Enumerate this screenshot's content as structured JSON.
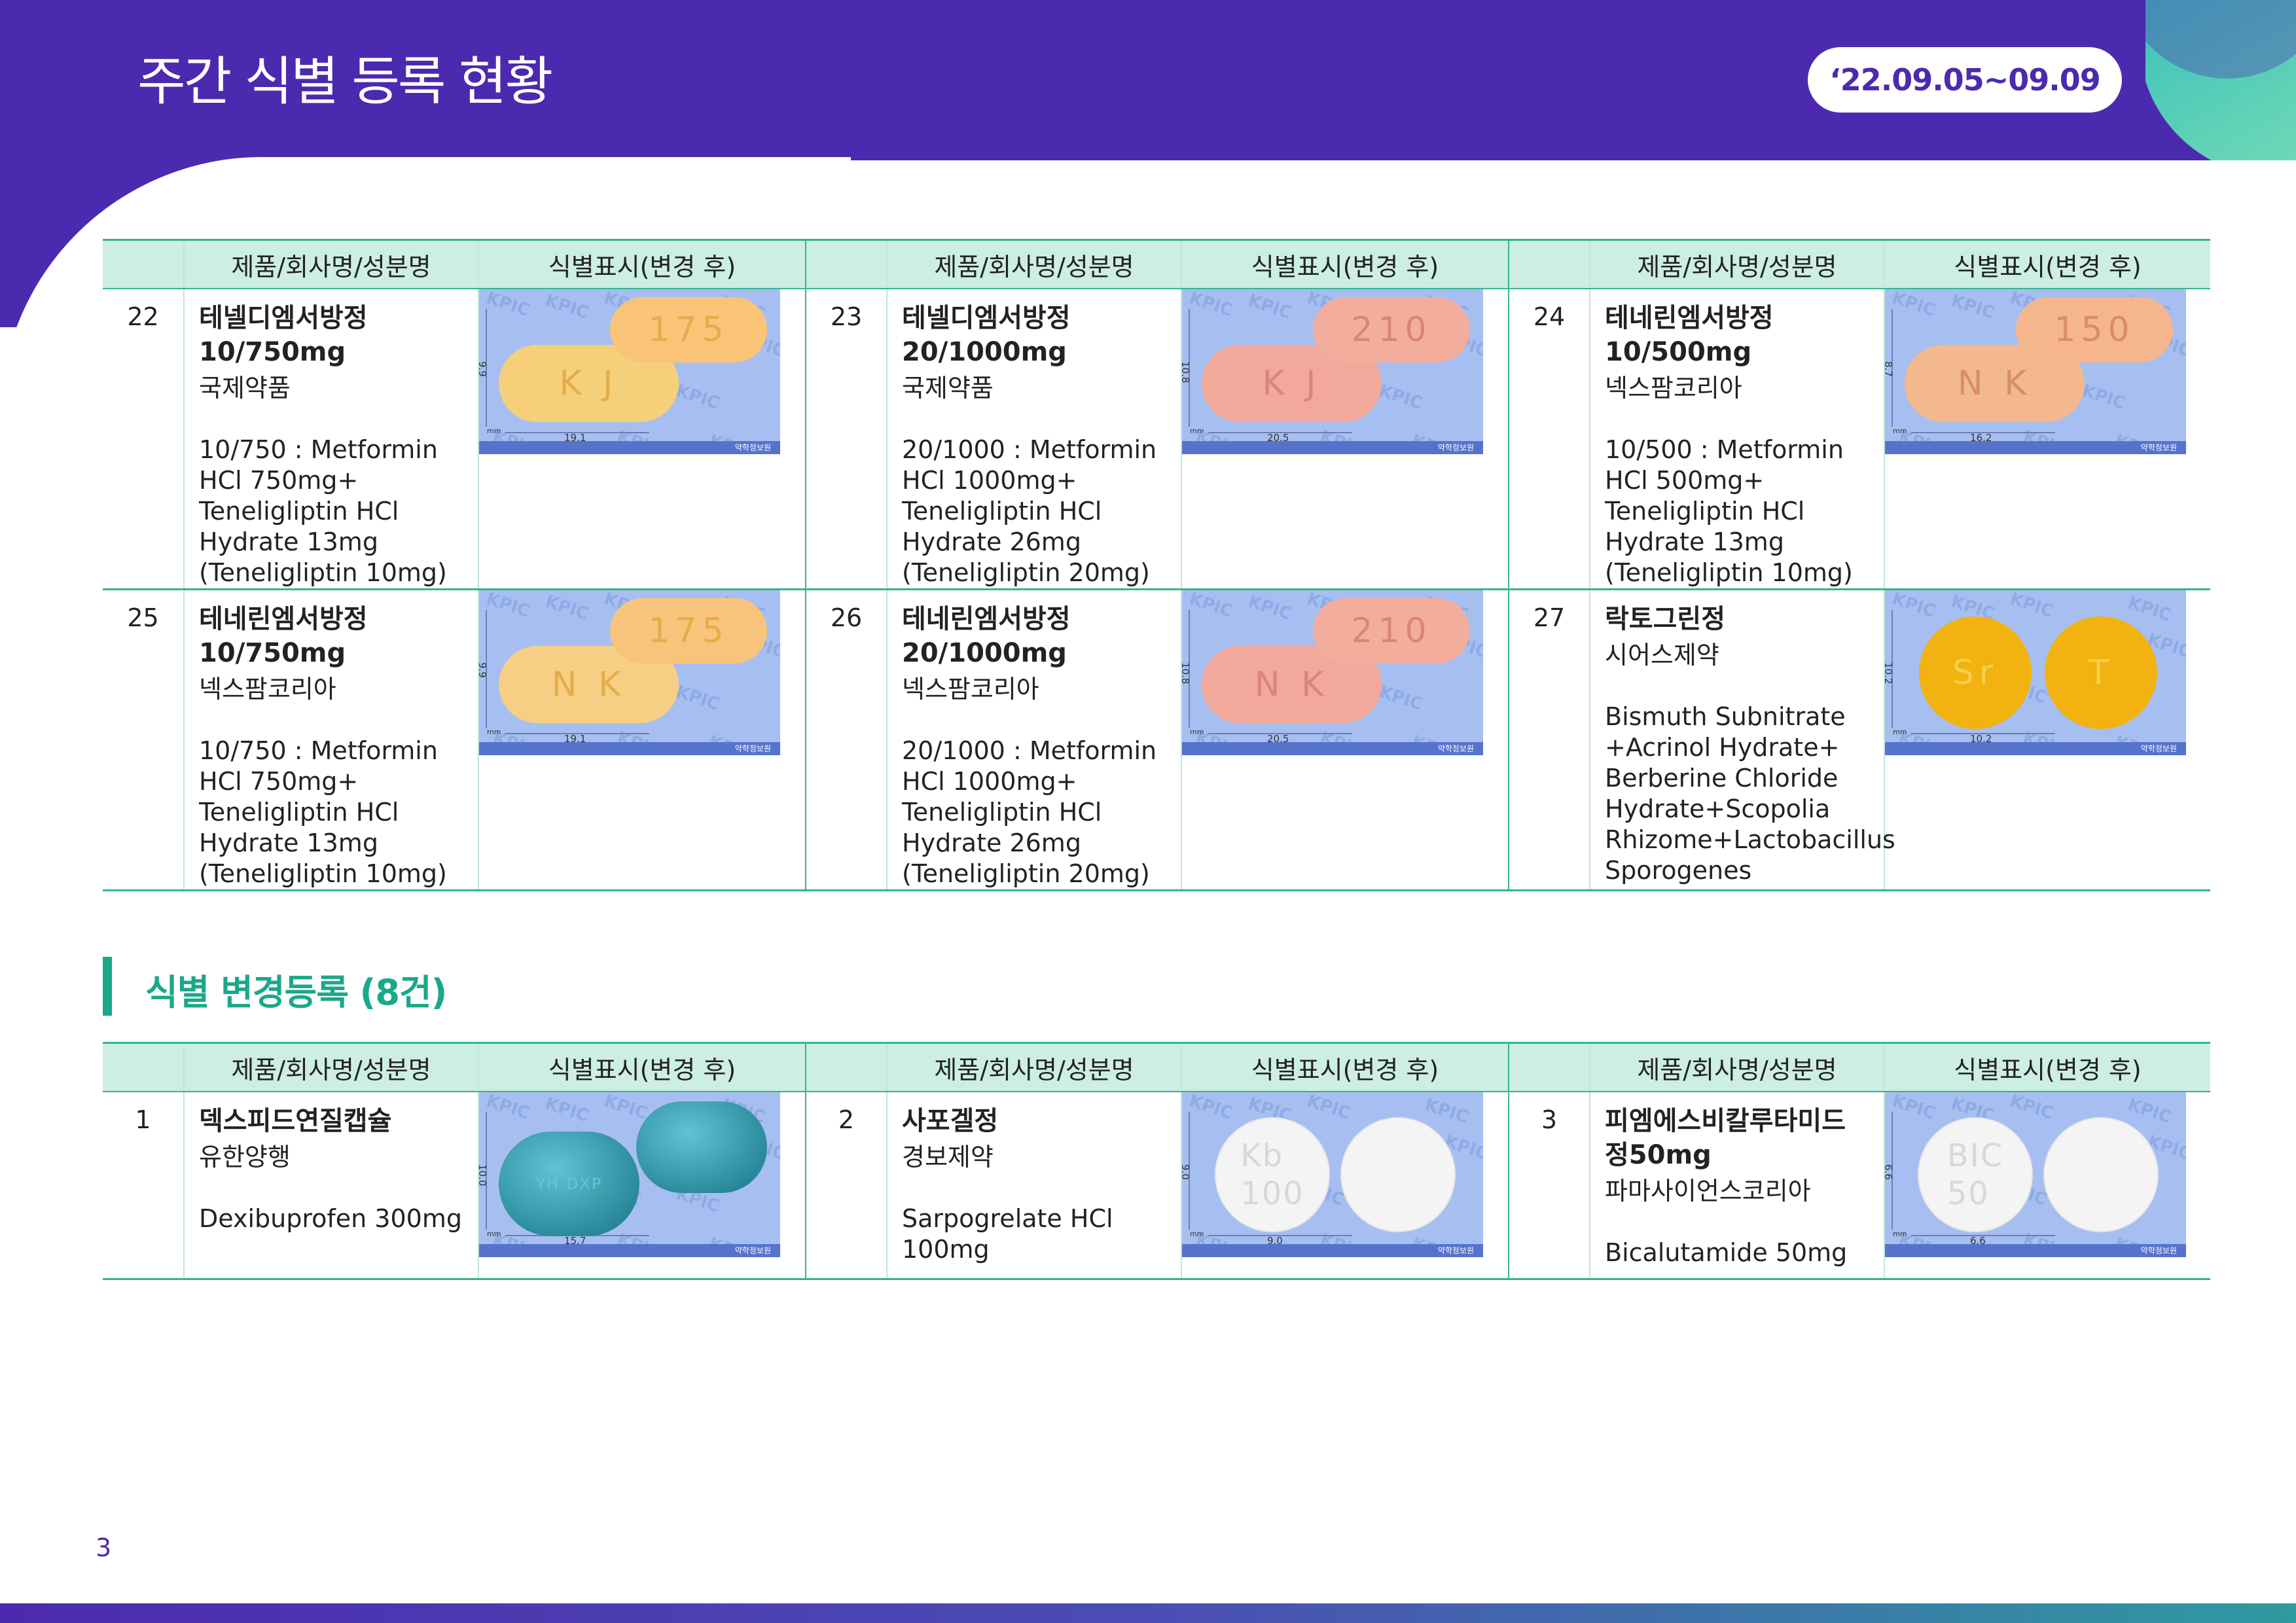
{
  "header": {
    "title": "주간 식별 등록 현황",
    "date_range": "‘22.09.05~09.09"
  },
  "table_headers": {
    "product": "제품/회사명/성분명",
    "marking": "식별표시(변경 후)"
  },
  "table1": {
    "rows": [
      [
        {
          "no": "22",
          "name": "테넬디엠서방정\n10/750mg",
          "company": "국제약품",
          "ingredients": "10/750 : Metformin\nHCl 750mg+\nTeneligliptin HCl\nHydrate 13mg\n(Teneligliptin 10mg)",
          "image": {
            "shape": "oval",
            "colors": [
              "#f6cf7a",
              "#f9c477"
            ],
            "marks": [
              "K J",
              "175"
            ],
            "height_label": "9.9",
            "width_label": "19.1"
          }
        },
        {
          "no": "23",
          "name": "테넬디엠서방정\n20/1000mg",
          "company": "국제약품",
          "ingredients": "20/1000 : Metformin\nHCl 1000mg+\nTeneligliptin HCl\nHydrate 26mg\n(Teneligliptin 20mg)",
          "image": {
            "shape": "oval",
            "colors": [
              "#f2a89a",
              "#f3ad9d"
            ],
            "marks": [
              "K J",
              "210"
            ],
            "height_label": "10.8",
            "width_label": "20.5"
          }
        },
        {
          "no": "24",
          "name": "테네린엠서방정\n10/500mg",
          "company": "넥스팜코리아",
          "ingredients": "10/500 : Metformin\nHCl 500mg+\nTeneligliptin HCl\nHydrate 13mg\n(Teneligliptin 10mg)",
          "image": {
            "shape": "oval",
            "colors": [
              "#f4b88e",
              "#f5b68d"
            ],
            "marks": [
              "N K",
              "150"
            ],
            "height_label": "8.7",
            "width_label": "16.2"
          }
        }
      ],
      [
        {
          "no": "25",
          "name": "테네린엠서방정\n10/750mg",
          "company": "넥스팜코리아",
          "ingredients": "10/750 : Metformin\nHCl 750mg+\nTeneligliptin HCl\nHydrate 13mg\n(Teneligliptin 10mg)",
          "image": {
            "shape": "oval",
            "colors": [
              "#f6cf84",
              "#f8c47c"
            ],
            "marks": [
              "N K",
              "175"
            ],
            "height_label": "9.9",
            "width_label": "19.1"
          }
        },
        {
          "no": "26",
          "name": "테네린엠서방정\n20/1000mg",
          "company": "넥스팜코리아",
          "ingredients": "20/1000 : Metformin\nHCl 1000mg+\nTeneligliptin HCl\nHydrate 26mg\n(Teneligliptin 20mg)",
          "image": {
            "shape": "oval",
            "colors": [
              "#f2a89a",
              "#f3ad9d"
            ],
            "marks": [
              "N K",
              "210"
            ],
            "height_label": "10.8",
            "width_label": "20.5"
          }
        },
        {
          "no": "27",
          "name": "락토그린정",
          "company": "시어스제약",
          "ingredients": "Bismuth Subnitrate\n+Acrinol Hydrate+\nBerberine Chloride\nHydrate+Scopolia\nRhizome+Lactobacillus\nSporogenes",
          "image": {
            "shape": "round",
            "colors": [
              "#f2b20f",
              "#f2b20f"
            ],
            "marks": [
              "Sr",
              "T"
            ],
            "height_label": "10.2",
            "width_label": "10.2"
          }
        }
      ]
    ]
  },
  "section": {
    "title": "식별 변경등록 (8건)"
  },
  "table2": {
    "rows": [
      [
        {
          "no": "1",
          "name": "덱스피드연질캡슐",
          "company": "유한양행",
          "ingredients": "Dexibuprofen 300mg",
          "image": {
            "shape": "capsule",
            "colors": [
              "#1f8a9f",
              "#1f8a9f"
            ],
            "marks": [
              "YH DXP",
              ""
            ],
            "height_label": "10.0",
            "width_label": "15.7"
          }
        },
        {
          "no": "2",
          "name": "사포겔정",
          "company": "경보제약",
          "ingredients": "Sarpogrelate HCl\n100mg",
          "image": {
            "shape": "round",
            "colors": [
              "#f4f4f4",
              "#f4f4f4"
            ],
            "marks": [
              "Kb\n100",
              ""
            ],
            "height_label": "9.0",
            "width_label": "9.0"
          }
        },
        {
          "no": "3",
          "name": "피엠에스비칼루타미드\n정50mg",
          "company": "파마사이언스코리아",
          "ingredients": "Bicalutamide 50mg",
          "image": {
            "shape": "round",
            "colors": [
              "#f4f4f4",
              "#f4f4f4"
            ],
            "marks": [
              "BIC\n50",
              ""
            ],
            "height_label": "6.6",
            "width_label": "6.6"
          }
        }
      ]
    ]
  },
  "watermark": "KPIC",
  "image_source": "약학정보원",
  "unit": "mm",
  "footer": {
    "page": "3"
  },
  "colors": {
    "primary": "#4c2aaf",
    "accent": "#1aa88a",
    "header_fill": "#cdeee4"
  }
}
